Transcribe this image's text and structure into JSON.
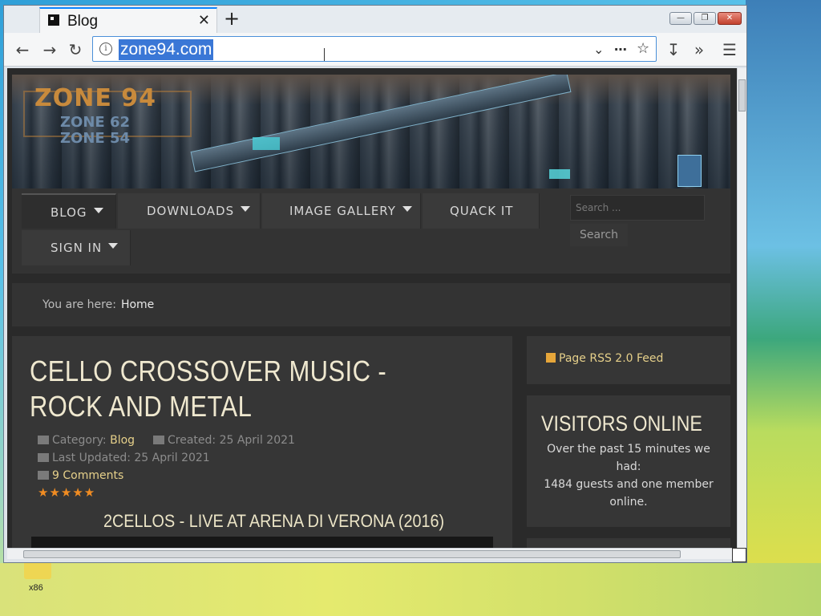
{
  "browser": {
    "tab_title": "Blog",
    "tab_close": "✕",
    "new_tab": "+",
    "url": "zone94.com",
    "window_buttons": {
      "minimize": "—",
      "restore": "❐",
      "close": "✕"
    }
  },
  "site": {
    "logo": {
      "main": "ZONE 94",
      "sub1": "ZONE 62",
      "sub2": "ZONE 54"
    },
    "menu": {
      "blog": "BLOG",
      "downloads": "DOWNLOADS",
      "image_gallery": "IMAGE GALLERY",
      "quack_it": "QUACK IT",
      "sign_in": "SIGN IN"
    },
    "search": {
      "placeholder": "Search ...",
      "button": "Search"
    },
    "breadcrumb": {
      "prefix": "You are here:",
      "current": "Home"
    }
  },
  "article": {
    "title": "CELLO CROSSOVER MUSIC - ROCK AND METAL",
    "category_label": "Category:",
    "category": "Blog",
    "created": "Created: 25 April 2021",
    "updated": "Last Updated: 25 April 2021",
    "comments": "9 Comments",
    "rating_stars": 5,
    "stars_text": "★★★★★",
    "subheading": "2CELLOS - LIVE AT ARENA DI VERONA (2016)"
  },
  "sidebar": {
    "rss": "Page RSS 2.0 Feed",
    "visitors_heading": "VISITORS ONLINE",
    "visitors_line1": "Over the past 15 minutes we had:",
    "visitors_line2": "1484 guests and one member online."
  },
  "desktop": {
    "icon_label": "x86"
  },
  "colors": {
    "accent": "#e6d08a",
    "stars": "#f08c22",
    "selection": "#3a77d6"
  }
}
